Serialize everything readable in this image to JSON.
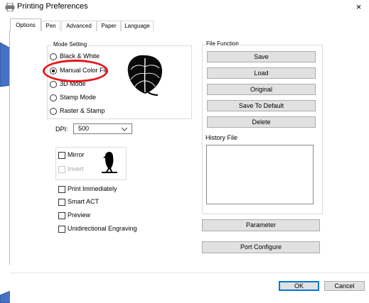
{
  "window": {
    "title": "Printing Preferences",
    "close_glyph": "×",
    "icon": "printer-icon"
  },
  "tabs": [
    {
      "label": "Options",
      "active": true
    },
    {
      "label": "Pen",
      "active": false
    },
    {
      "label": "Advanced",
      "active": false
    },
    {
      "label": "Paper",
      "active": false
    },
    {
      "label": "Language",
      "active": false
    }
  ],
  "mode_setting": {
    "legend": "Mode Setting",
    "options": [
      {
        "label": "Black & White",
        "checked": false
      },
      {
        "label": "Manual Color Fill",
        "checked": true
      },
      {
        "label": "3D Mode",
        "checked": false
      },
      {
        "label": "Stamp Mode",
        "checked": false
      },
      {
        "label": "Raster & Stamp",
        "checked": false
      }
    ],
    "preview_icon": "anthurium-leaf-icon"
  },
  "dpi": {
    "label": "DPI:",
    "value": "500"
  },
  "mirror_group": {
    "mirror_label": "Mirror",
    "mirror_checked": false,
    "invert_label": "Invert",
    "invert_checked": false,
    "invert_disabled": true,
    "preview_icon": "bird-silhouette-icon"
  },
  "options_checks": [
    {
      "label": "Print Immediately",
      "checked": false
    },
    {
      "label": "Smart ACT",
      "checked": false
    },
    {
      "label": "Preview",
      "checked": false
    },
    {
      "label": "Unidirectional Engraving",
      "checked": false
    }
  ],
  "file_function": {
    "legend": "File Function",
    "buttons": [
      "Save",
      "Load",
      "Original",
      "Save To Default",
      "Delete"
    ],
    "history_label": "History File"
  },
  "parameter_button": "Parameter",
  "port_configure_button": "Port Configure",
  "footer": {
    "ok_label": "OK",
    "cancel_label": "Cancel"
  },
  "colors": {
    "highlight_ellipse": "#e8151b",
    "annotation_arrow": "#4472c4",
    "button_face": "#e1e1e1",
    "default_button_border": "#0078d7"
  }
}
